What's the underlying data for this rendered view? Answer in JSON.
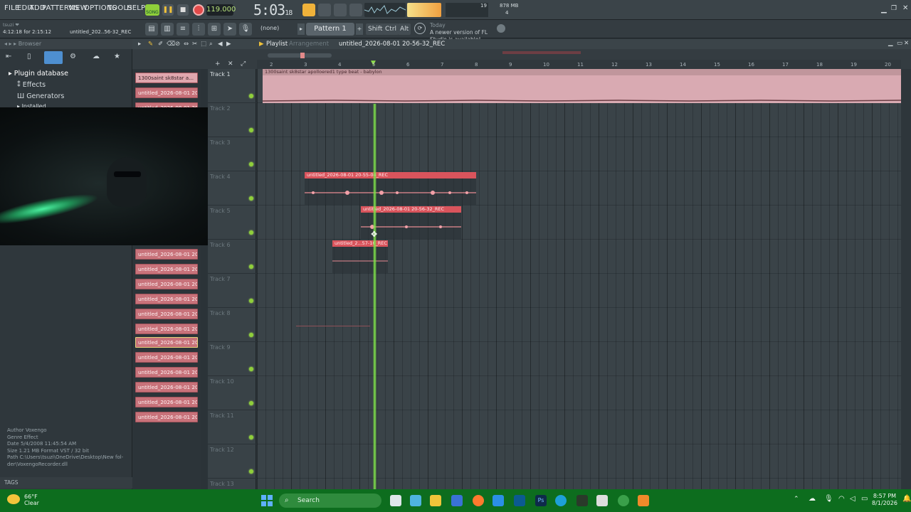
{
  "menu": {
    "items": [
      "FILE",
      "EDIT",
      "ADD",
      "PATTERNS",
      "VIEW",
      "OPTIONS",
      "TOOLS",
      "HELP"
    ]
  },
  "transport": {
    "song_mode": "SONG",
    "tempo": "119.000",
    "time": "5:03",
    "time_sub": "18",
    "cpu": "19",
    "mem": "878 MB",
    "voices": "4"
  },
  "toolbar2": {
    "hint_left": "4:12:18 for 2:15:12",
    "hint_right": "untitled_202..56-32_REC",
    "snap": "(none)",
    "pattern": "Pattern 1",
    "keys": [
      "Shift",
      "Ctrl",
      "Alt"
    ],
    "news_title": "Today",
    "news_text": "A newer version of FL Studio is available!"
  },
  "browser": {
    "header": "Browser",
    "tree": [
      "Plugin database",
      "Effects",
      "Generators",
      "Installed"
    ],
    "info": [
      {
        "k": "Author",
        "v": "Voxengo"
      },
      {
        "k": "Genre",
        "v": "Effect"
      },
      {
        "k": "Date",
        "v": "5/4/2008 11:45:54 AM"
      },
      {
        "k": "Size",
        "v": "1.21 MB    Format  VST / 32 bit"
      },
      {
        "k": "Path",
        "v": "C:\\Users\\tsuzi\\OneDrive\\Desktop\\New fol-der\\VoxengoRecorder.dll"
      }
    ],
    "tags": "TAGS"
  },
  "picker": {
    "items": [
      "1300saint sk8star a...",
      "untitled_2026-08-01 20-...",
      "untitled_2026-08-01 20-...",
      "untitled_2026-08-01 20-...",
      "untitled_2026-08-01 20-...",
      "untitled_2026-08-01 20-...",
      "untitled_2026-08-01 20-...",
      "untitled_2026-08-01 20-...",
      "untitled_2026-08-01 20-...",
      "untitled_2026-08-01 20-...",
      "untitled_2026-08-01 20-...",
      "untitled_2026-08-01 20-...",
      "untitled_2026-08-01 20-...",
      "untitled_2026-08-01 20-...",
      "untitled_2026-08-01 20-..."
    ]
  },
  "playlist": {
    "title": "Playlist",
    "subtitle": "Arrangement",
    "clip_title": "untitled_2026-08-01 20-56-32_REC",
    "tracks": [
      "Track 1",
      "Track 2",
      "Track 3",
      "Track 4",
      "Track 5",
      "Track 6",
      "Track 7",
      "Track 8",
      "Track 9",
      "Track 10",
      "Track 11",
      "Track 12",
      "Track 13"
    ],
    "ruler": [
      "2",
      "3",
      "4",
      "5",
      "6",
      "7",
      "8",
      "9",
      "10",
      "11",
      "12",
      "13",
      "14",
      "15",
      "16",
      "17",
      "18",
      "19",
      "20"
    ],
    "clips": [
      {
        "name": "1300saint  sk8star  apolloered1 type beat - babylon"
      },
      {
        "name": "untitled_2026-08-01 20-55-04_REC"
      },
      {
        "name": "untitled_2026-08-01 20-56-32_REC"
      },
      {
        "name": "untitled_2...57-16_REC"
      }
    ]
  },
  "taskbar": {
    "temp": "66°F",
    "condition": "Clear",
    "search": "Search",
    "time": "8:57 PM",
    "date": "8/1/2026"
  }
}
